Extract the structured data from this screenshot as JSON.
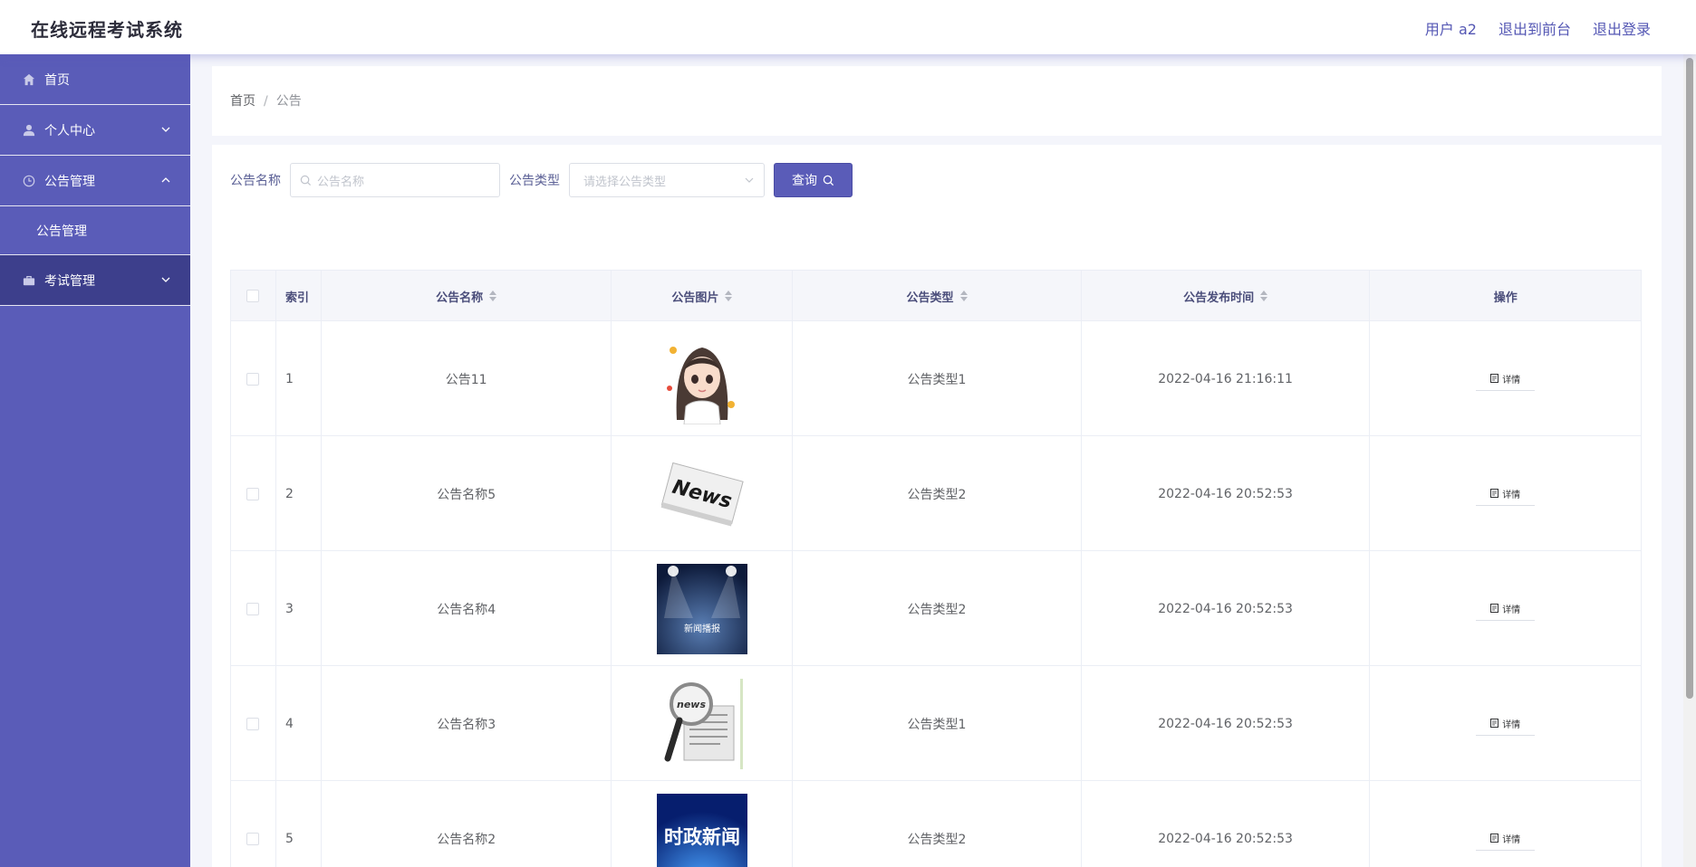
{
  "header": {
    "app_title": "在线远程考试系统",
    "links": [
      "用户 a2",
      "退出到前台",
      "退出登录"
    ]
  },
  "sidebar": {
    "items": [
      {
        "label": "首页",
        "icon": "home-icon"
      },
      {
        "label": "个人中心",
        "icon": "user-icon"
      },
      {
        "label": "公告管理",
        "icon": "clock-icon"
      },
      {
        "label": "公告管理",
        "icon": ""
      },
      {
        "label": "考试管理",
        "icon": "briefcase-icon"
      }
    ]
  },
  "breadcrumb": {
    "home": "首页",
    "separator": "/",
    "current": "公告"
  },
  "filters": {
    "name_label": "公告名称",
    "name_placeholder": "公告名称",
    "type_label": "公告类型",
    "type_placeholder": "请选择公告类型",
    "query_button": "查询"
  },
  "table": {
    "headers": [
      "索引",
      "公告名称",
      "公告图片",
      "公告类型",
      "公告发布时间",
      "操作"
    ],
    "detail_label": "详情",
    "rows": [
      {
        "index": "1",
        "name": "公告11",
        "image": "girl-cartoon",
        "type": "公告类型1",
        "time": "2022-04-16 21:16:11"
      },
      {
        "index": "2",
        "name": "公告名称5",
        "image": "news-paper",
        "type": "公告类型2",
        "time": "2022-04-16 20:52:53"
      },
      {
        "index": "3",
        "name": "公告名称4",
        "image": "stage-news",
        "type": "公告类型2",
        "time": "2022-04-16 20:52:53"
      },
      {
        "index": "4",
        "name": "公告名称3",
        "image": "magnifier-news",
        "type": "公告类型1",
        "time": "2022-04-16 20:52:53"
      },
      {
        "index": "5",
        "name": "公告名称2",
        "image": "politics-news",
        "type": "公告类型2",
        "time": "2022-04-16 20:52:53"
      }
    ]
  },
  "images": {
    "stage_caption": "新闻播报",
    "news_word": "News",
    "news_lower": "news",
    "politics_caption": "时政新闻"
  },
  "colors": {
    "accent": "#5a5cb8",
    "accent_dark": "#3d3f8c",
    "link": "#5457b4"
  }
}
